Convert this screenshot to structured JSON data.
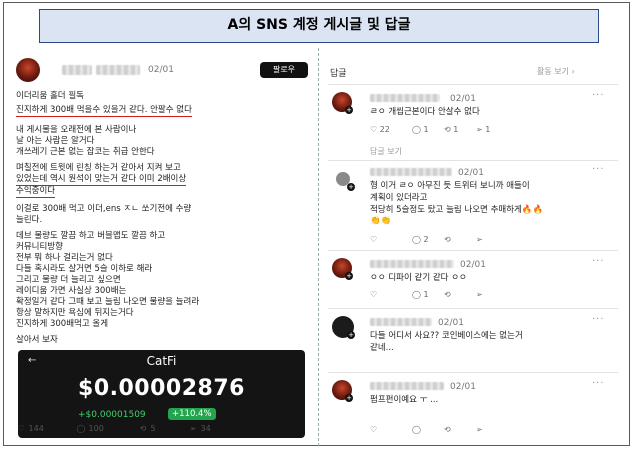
{
  "title": "A의 SNS 계정 게시글 및 답글",
  "post": {
    "date": "02/01",
    "follow_label": "팔로우",
    "lines": [
      "이더리움 홀더 필독",
      "진지하게 300배 먹을수 있을거 같다. 안팔수 없다",
      "내 게시물을 오래전에 본 사람이나",
      "날 아는 사람은 알거다",
      "개쓰레기 근본 없는 잡코는 취급 안한다",
      "며칠전에 트윗에 린칭 하는거 같아서 지켜 보고",
      "있었는데 역시 원석이 맞는거 같다 이미 2배이상",
      "수익중이다",
      "이걸로 300배 먹고 이더,ens ㅈㄴ 쏘기전에 수량",
      "늘린다.",
      "데브 물량도 깔끔 하고 버블맵도 깔끔 하고",
      "커뮤니티방향",
      "전부 뭐 하나 걸리는거 없다",
      "다들 혹시라도 살거면 5슬 이하로 해라",
      "그리고 물량 더 늘리고 싶으면",
      "레이디움 가면 사실상 300배는",
      " 확정일거 같다 그때 보고 늘림 나오면 물량을 늘려라",
      "항상 말하지만 욕심에 뒤지는거다",
      "진지하게 300배먹고 올게",
      "살아서 보자"
    ],
    "catfi": {
      "back": "←",
      "name": "CatFi",
      "price": "$0.00002876",
      "change": "+$0.00001509",
      "pct": "+110.4%"
    },
    "stats": {
      "likes": "144",
      "comments": "100",
      "reposts": "5",
      "shares": "34"
    }
  },
  "replies": {
    "header": "답글",
    "view_activity": "활동 보기 ›",
    "items": [
      {
        "date": "02/01",
        "text": "ㄹㅇ 개씹근본이다 안살수 없다",
        "likes": "22",
        "comments": "1",
        "reposts": "1",
        "shares": "1",
        "more_replies": "답글 보기"
      },
      {
        "date": "02/01",
        "lines": [
          "형 이거 ㄹㅇ 아무진 듯 트위터 보니까 애들이",
          "계획이 있더라고",
          "적당히 5슬정도 탔고 늘림 나오면 추매하게🔥🔥"
        ],
        "emoji": "👏👏",
        "likes": "",
        "comments": "2",
        "reposts": "",
        "shares": ""
      },
      {
        "date": "02/01",
        "text": "ㅇㅇ 디파이 같기 같다 ㅇㅇ",
        "likes": "",
        "comments": "1",
        "reposts": "",
        "shares": ""
      },
      {
        "date": "02/01",
        "lines": [
          "다들 어디서 사요?? 코인베이스에는 없는거",
          "같네..."
        ],
        "likes": "",
        "comments": "",
        "reposts": "",
        "shares": ""
      },
      {
        "date": "02/01",
        "text": "펌프펀이예요 ㅜ ...",
        "likes": "",
        "comments": "",
        "reposts": "",
        "shares": ""
      }
    ]
  },
  "icons": {
    "like": "heart-icon",
    "comment": "comment-icon",
    "repost": "repost-icon",
    "share": "share-icon",
    "more": "more-icon"
  },
  "colors": {
    "underline": "#d21b1b",
    "title_border": "#2e4a86",
    "title_bg": "#dbe4f3",
    "catfi_green": "#3fd06a"
  }
}
